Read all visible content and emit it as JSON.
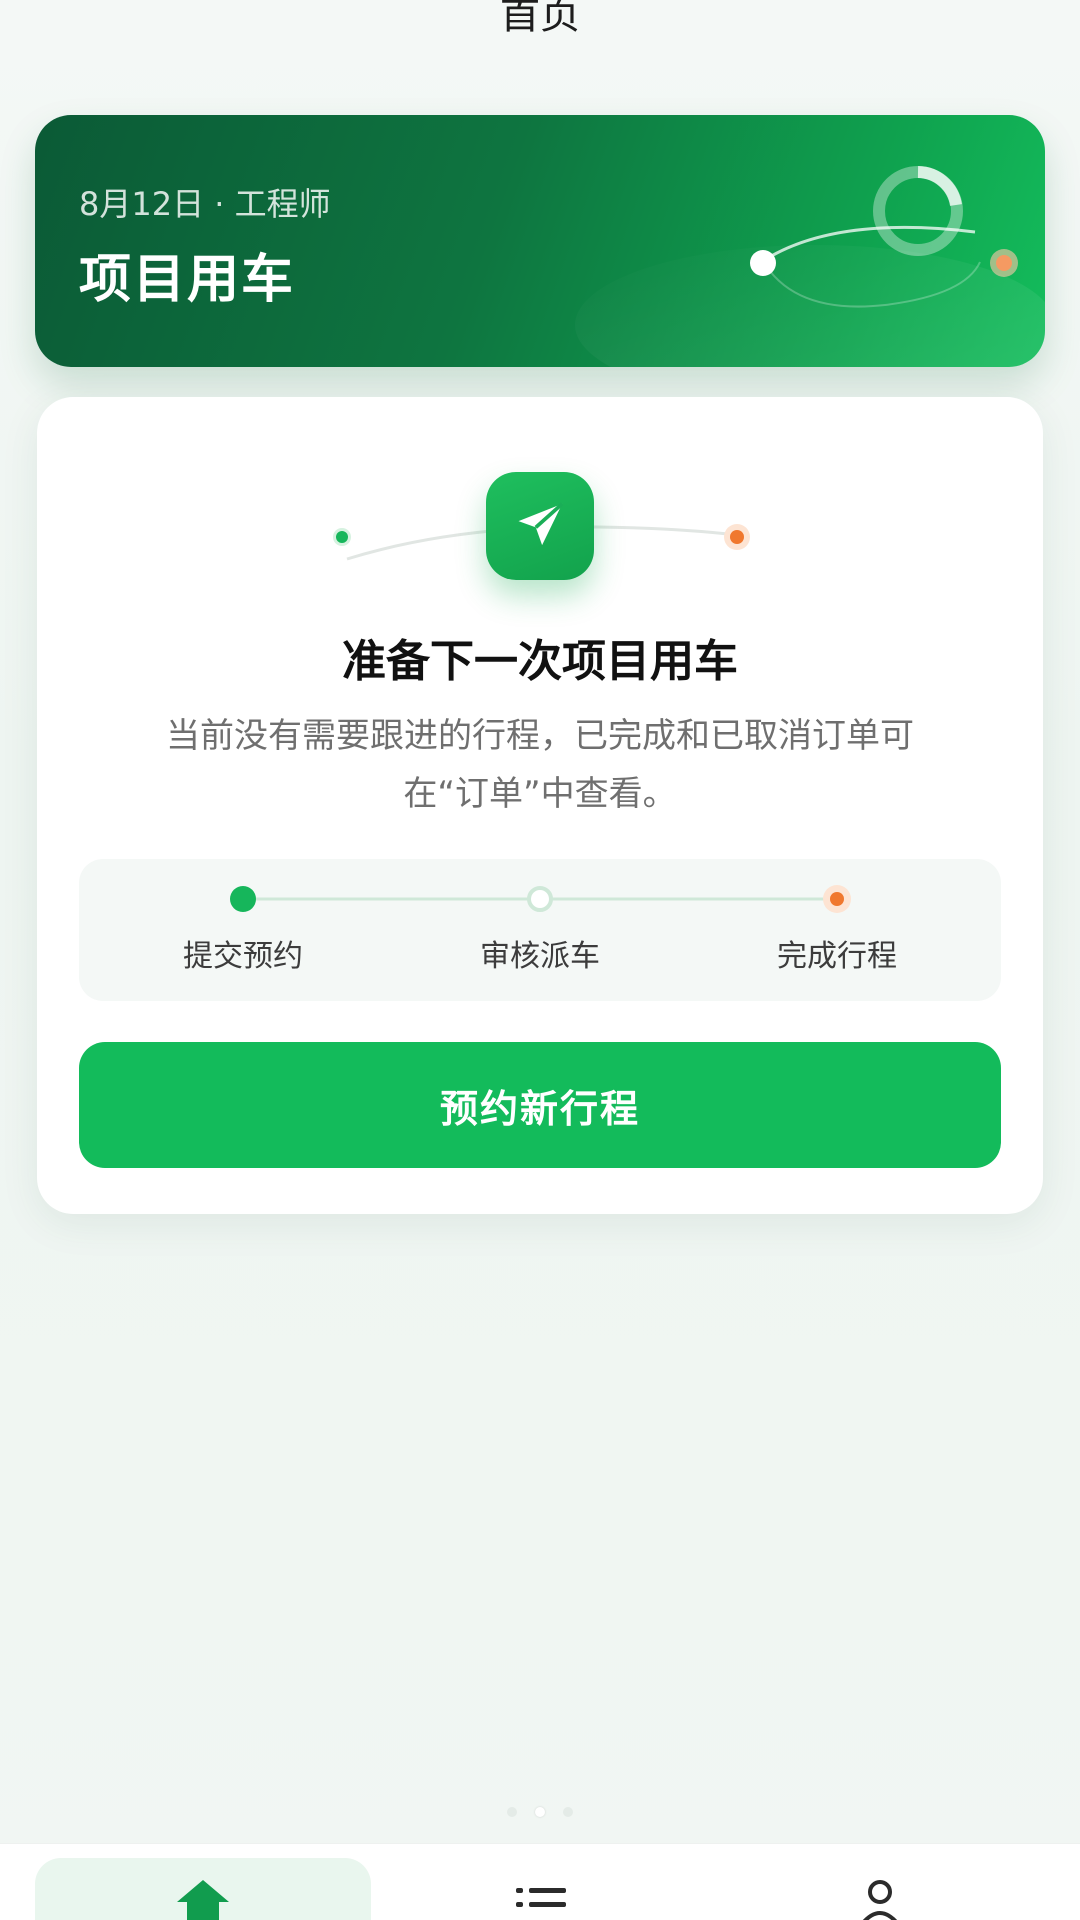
{
  "nav": {
    "title": "首页"
  },
  "hero": {
    "subtitle": "8月12日 · 工程师",
    "title": "项目用车"
  },
  "empty_state": {
    "icon": "send-icon",
    "heading": "准备下一次项目用车",
    "description": "当前没有需要跟进的行程，已完成和已取消订单可在“订单”中查看。"
  },
  "steps": [
    {
      "label": "提交预约",
      "status": "active"
    },
    {
      "label": "审核派车",
      "status": "pending"
    },
    {
      "label": "完成行程",
      "status": "end"
    }
  ],
  "cta": {
    "label": "预约新行程"
  },
  "page_indicator": {
    "count": 3,
    "active": 2
  },
  "tabbar": {
    "tabs": [
      {
        "icon": "home-icon",
        "active": true
      },
      {
        "icon": "list-icon",
        "active": false
      },
      {
        "icon": "user-icon",
        "active": false
      }
    ]
  },
  "colors": {
    "primary": "#13bb5b",
    "hero_dark": "#0b5a36",
    "accent_orange": "#f0782e",
    "text_secondary": "#6f6f6f"
  }
}
